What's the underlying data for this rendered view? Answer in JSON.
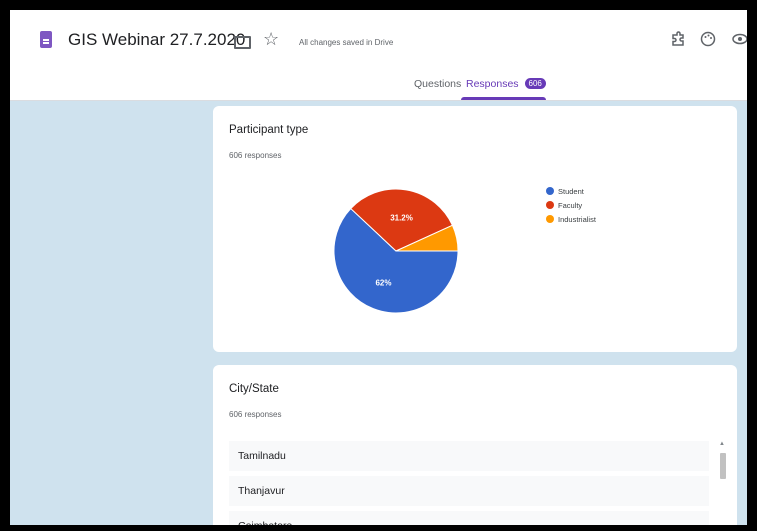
{
  "header": {
    "form_title": "GIS Webinar 27.7.2020",
    "save_status": "All changes saved in Drive"
  },
  "tabs": {
    "questions": "Questions",
    "responses": "Responses",
    "responses_count": "606"
  },
  "participant_card": {
    "title": "Participant type",
    "responses": "606 responses"
  },
  "city_card": {
    "title": "City/State",
    "responses": "606 responses",
    "rows": [
      "Tamilnadu",
      "Thanjavur",
      "Coimbatore"
    ]
  },
  "chart_data": {
    "type": "pie",
    "title": "Participant type",
    "slices": [
      {
        "name": "Student",
        "value": 62,
        "label": "62%",
        "color": "#3366cc"
      },
      {
        "name": "Faculty",
        "value": 31.2,
        "label": "31.2%",
        "color": "#dc3912"
      },
      {
        "name": "Industrialist",
        "value": 6.8,
        "label": "",
        "color": "#ff9900"
      }
    ],
    "legend_position": "right"
  },
  "icons": [
    "form-icon",
    "folder-icon",
    "star-icon",
    "addon-icon",
    "palette-icon",
    "preview-icon"
  ]
}
